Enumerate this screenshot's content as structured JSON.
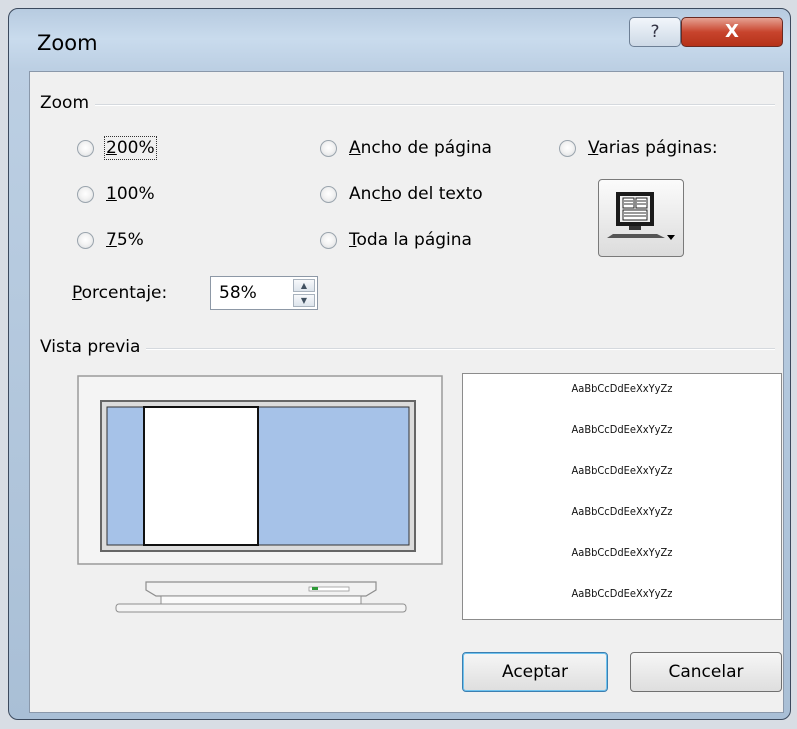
{
  "window": {
    "title": "Zoom",
    "help_glyph": "?",
    "close_glyph": "X"
  },
  "zoom_group": {
    "label": "Zoom",
    "options": [
      {
        "pre": "",
        "acc": "2",
        "post": "00%"
      },
      {
        "pre": "",
        "acc": "1",
        "post": "00%"
      },
      {
        "pre": "",
        "acc": "7",
        "post": "5%"
      },
      {
        "pre": "",
        "acc": "A",
        "post": "ncho de página"
      },
      {
        "pre": "Anc",
        "acc": "h",
        "post": "o del texto"
      },
      {
        "pre": "",
        "acc": "T",
        "post": "oda la página"
      },
      {
        "pre": "",
        "acc": "V",
        "post": "arias páginas:"
      }
    ],
    "percent_label_acc": "P",
    "percent_label_rest": "orcentaje:",
    "percent_value": "58%"
  },
  "preview_group": {
    "label": "Vista previa",
    "sample_text": "AaBbCcDdEeXxYyZz",
    "sample_lines": [
      "AaBbCcDdEeXxYyZz",
      "AaBbCcDdEeXxYyZz",
      "AaBbCcDdEeXxYyZz",
      "AaBbCcDdEeXxYyZz",
      "AaBbCcDdEeXxYyZz",
      "AaBbCcDdEeXxYyZz"
    ]
  },
  "buttons": {
    "ok": "Aceptar",
    "cancel": "Cancelar"
  },
  "colors": {
    "preview_area": "#a6c2e8",
    "close_button": "#c8442d"
  },
  "icons": [
    "help-icon",
    "close-icon",
    "multiple-pages-icon",
    "spin-up-icon",
    "spin-down-icon"
  ]
}
